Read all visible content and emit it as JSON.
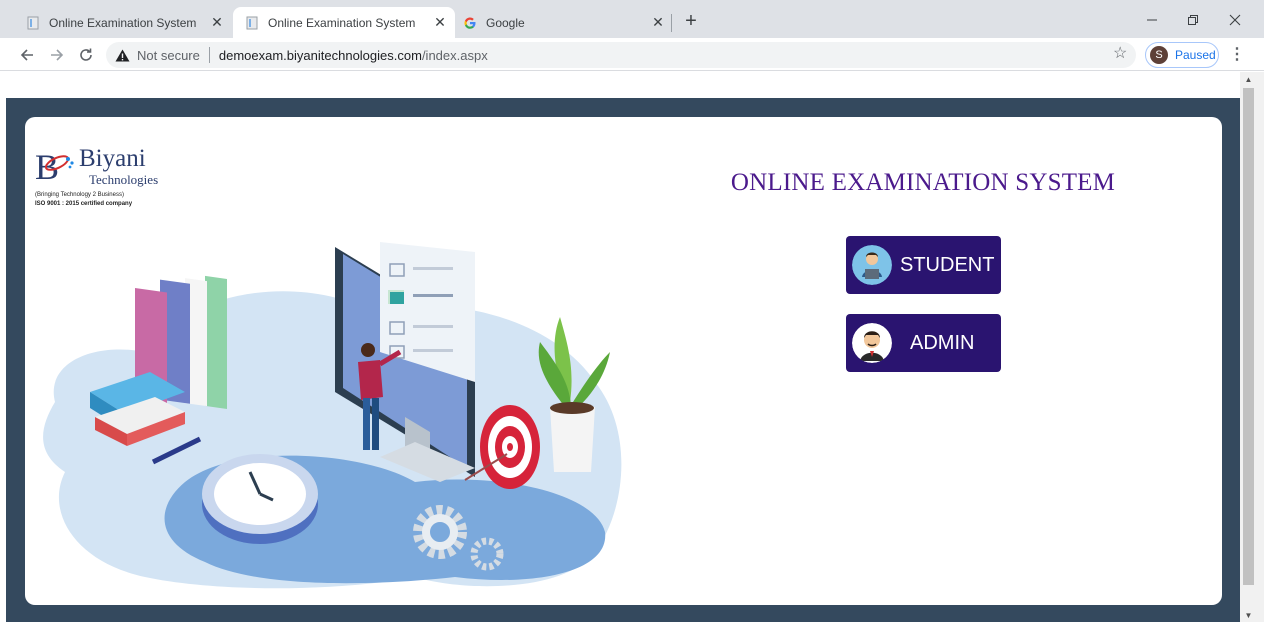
{
  "tabs": [
    {
      "title": "Online Examination System",
      "active": false,
      "icon": "page-icon"
    },
    {
      "title": "Online Examination System",
      "active": true,
      "icon": "page-icon"
    },
    {
      "title": "Google",
      "active": false,
      "icon": "google-icon"
    }
  ],
  "toolbar": {
    "security_label": "Not secure",
    "url_host": "demoexam.biyanitechnologies.com",
    "url_path": "/index.aspx",
    "profile_initial": "S",
    "profile_status": "Paused"
  },
  "page": {
    "logo": {
      "name_line1": "Biyani",
      "name_line2": "Technologies",
      "tagline": "(Bringing Technology 2 Business)",
      "certification": "ISO 9001 : 2015 certified company"
    },
    "heading": "ONLINE EXAMINATION SYSTEM",
    "buttons": {
      "student": "STUDENT",
      "admin": "ADMIN"
    }
  },
  "colors": {
    "page_background": "#34495e",
    "heading": "#4b1a8c",
    "button_background": "#2a1470"
  }
}
